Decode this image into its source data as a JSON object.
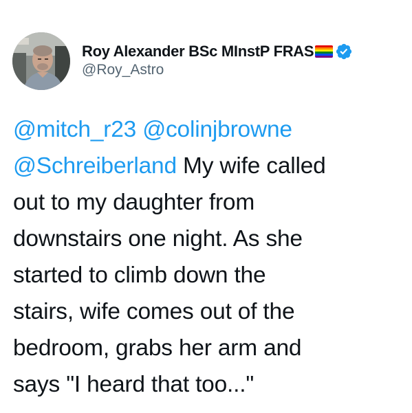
{
  "author": {
    "display_name": "Roy Alexander BSc MInstP FRAS",
    "handle": "@Roy_Astro",
    "flag_colors": [
      "#e40303",
      "#ff8c00",
      "#ffed00",
      "#008026",
      "#004dff",
      "#750787"
    ],
    "verified_color": "#1d9bf0"
  },
  "tweet": {
    "mentions": [
      "@mitch_r23",
      "@colinjbrowne",
      "@Schreiberland"
    ],
    "line1_rest": "My wife called",
    "line2": "out to my daughter from",
    "line3": "downstairs one night. As she",
    "line4": "started to climb down the",
    "line5": "stairs, wife comes out of the",
    "line6": "bedroom, grabs her arm and",
    "line7": "says \"I heard that too...\""
  },
  "colors": {
    "text": "#0f1419",
    "secondary": "#536471",
    "link": "#1d9bf0"
  }
}
